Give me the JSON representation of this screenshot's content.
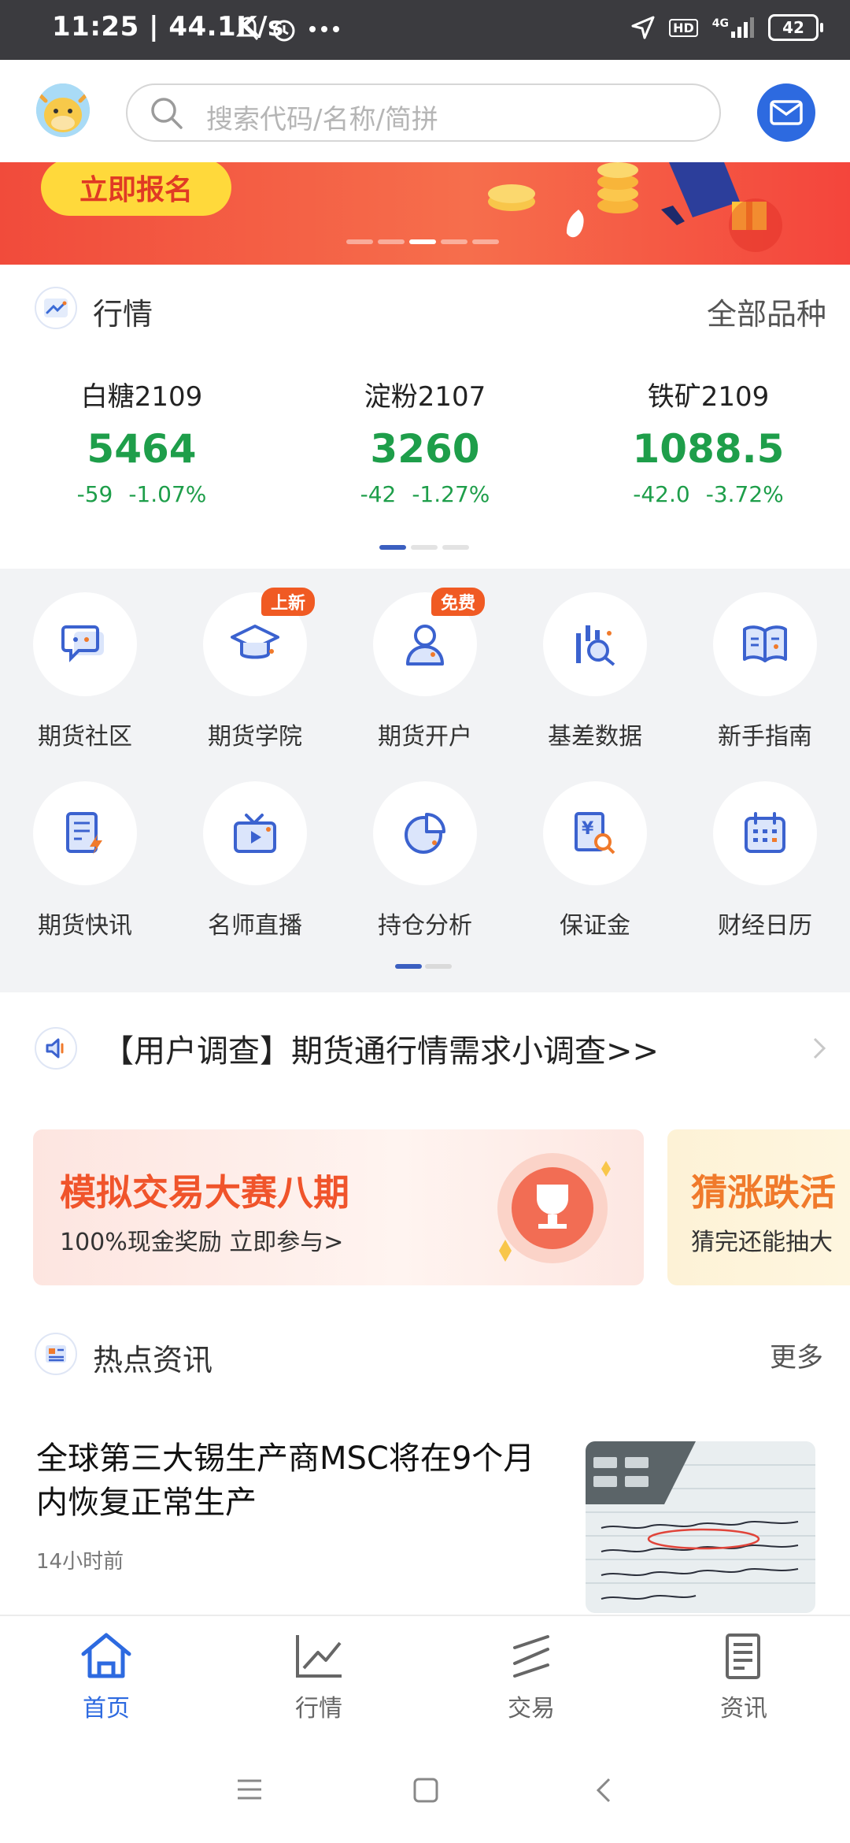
{
  "status_bar": {
    "time": "11:25 | 44.1K/s",
    "network": "4G",
    "hd": "HD",
    "battery": "42"
  },
  "header": {
    "search_placeholder": "搜索代码/名称/简拼"
  },
  "banner": {
    "cta": "立即报名"
  },
  "market": {
    "title": "行情",
    "more": "全部品种",
    "quotes": [
      {
        "name": "白糖2109",
        "price": "5464",
        "change": "-59",
        "pct": "-1.07%"
      },
      {
        "name": "淀粉2107",
        "price": "3260",
        "change": "-42",
        "pct": "-1.27%"
      },
      {
        "name": "铁矿2109",
        "price": "1088.5",
        "change": "-42.0",
        "pct": "-3.72%"
      }
    ]
  },
  "shortcuts": [
    {
      "label": "期货社区",
      "icon": "chat-icon"
    },
    {
      "label": "期货学院",
      "icon": "graduation-cap-icon",
      "badge": "上新"
    },
    {
      "label": "期货开户",
      "icon": "user-icon",
      "badge": "免费"
    },
    {
      "label": "基差数据",
      "icon": "data-search-icon"
    },
    {
      "label": "新手指南",
      "icon": "book-icon"
    },
    {
      "label": "期货快讯",
      "icon": "flash-news-icon"
    },
    {
      "label": "名师直播",
      "icon": "tv-play-icon"
    },
    {
      "label": "持仓分析",
      "icon": "pie-chart-icon"
    },
    {
      "label": "保证金",
      "icon": "yen-search-icon"
    },
    {
      "label": "财经日历",
      "icon": "calendar-icon"
    }
  ],
  "notice": {
    "text": "【用户调查】期货通行情需求小调查>>"
  },
  "promos": [
    {
      "title": "模拟交易大赛八期",
      "subtitle": "100%现金奖励 立即参与>"
    },
    {
      "title": "猜涨跌活",
      "subtitle": "猜完还能抽大"
    }
  ],
  "news": {
    "title": "热点资讯",
    "more": "更多",
    "headline": "全球第三大锡生产商MSC将在9个月内恢复正常生产",
    "time_ago": "14小时前"
  },
  "bottom_nav": [
    {
      "label": "首页",
      "active": true
    },
    {
      "label": "行情"
    },
    {
      "label": "交易"
    },
    {
      "label": "资讯"
    }
  ],
  "colors": {
    "accent": "#2d6ae0",
    "down": "#1e9e4a",
    "promo_red": "#f0542b"
  }
}
